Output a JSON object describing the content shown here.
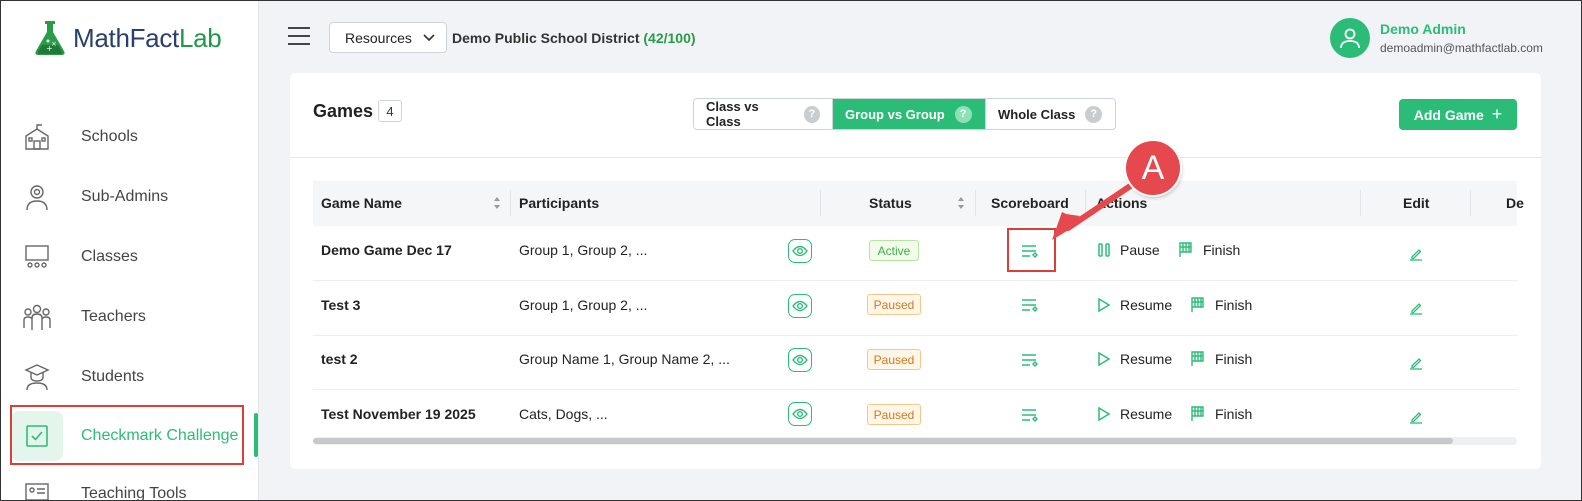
{
  "brand": {
    "name_main": "MathFact",
    "name_accent": "Lab"
  },
  "sidebar": {
    "items": [
      {
        "label": "Schools",
        "icon": "school-icon"
      },
      {
        "label": "Sub-Admins",
        "icon": "sub-admin-icon"
      },
      {
        "label": "Classes",
        "icon": "classroom-icon"
      },
      {
        "label": "Teachers",
        "icon": "teachers-icon"
      },
      {
        "label": "Students",
        "icon": "student-icon"
      },
      {
        "label": "Checkmark Challenge",
        "icon": "checkbox-icon",
        "active": true
      },
      {
        "label": "Teaching Tools",
        "icon": "teaching-tools-icon"
      }
    ]
  },
  "topbar": {
    "resources_label": "Resources",
    "district_name": "Demo Public School District",
    "district_count": "(42/100)",
    "user_name": "Demo Admin",
    "user_email": "demoadmin@mathfactlab.com"
  },
  "games": {
    "title": "Games",
    "count": "4",
    "tabs": [
      {
        "label": "Class vs Class",
        "active": false
      },
      {
        "label": "Group vs Group",
        "active": true
      },
      {
        "label": "Whole Class",
        "active": false
      }
    ],
    "help_glyph": "?",
    "add_label": "Add Game",
    "add_glyph": "+"
  },
  "table": {
    "headers": {
      "name": "Game Name",
      "participants": "Participants",
      "status": "Status",
      "scoreboard": "Scoreboard",
      "actions": "Actions",
      "edit": "Edit",
      "delete": "De"
    },
    "rows": [
      {
        "name": "Demo Game Dec 17",
        "participants": "Group 1, Group 2, ...",
        "status": "Active",
        "primary_action": "Pause",
        "secondary_action": "Finish"
      },
      {
        "name": "Test 3",
        "participants": "Group 1, Group 2, ...",
        "status": "Paused",
        "primary_action": "Resume",
        "secondary_action": "Finish"
      },
      {
        "name": "test 2",
        "participants": "Group Name 1, Group Name 2, ...",
        "status": "Paused",
        "primary_action": "Resume",
        "secondary_action": "Finish"
      },
      {
        "name": "Test November 19 2025",
        "participants": "Cats, Dogs, ...",
        "status": "Paused",
        "primary_action": "Resume",
        "secondary_action": "Finish"
      }
    ]
  },
  "annotation": {
    "label": "A"
  },
  "colors": {
    "accent": "#2bbd78",
    "highlight": "#d9403a",
    "callout": "#e5484d"
  }
}
